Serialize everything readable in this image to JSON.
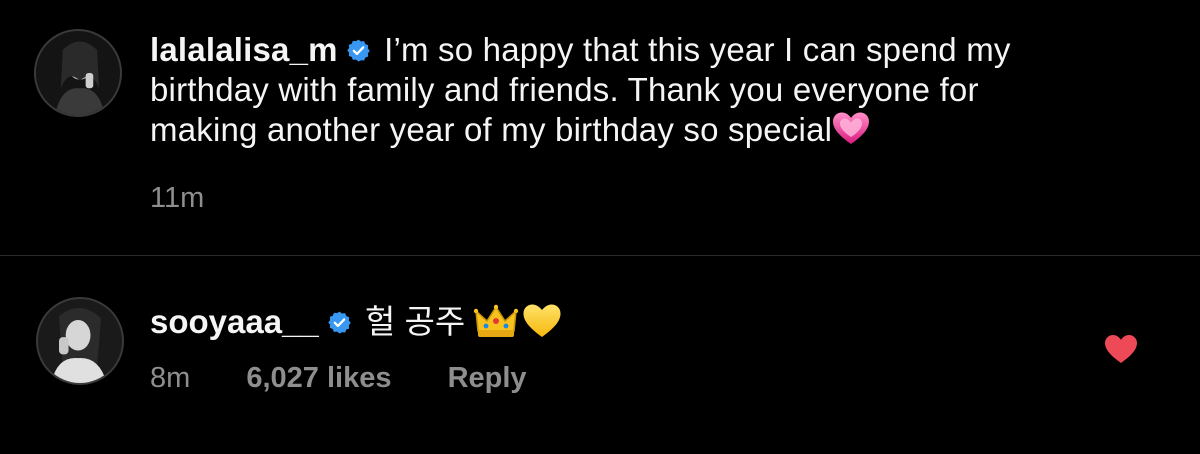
{
  "post": {
    "username": "lalalalisa_m",
    "verified": true,
    "caption": "I’m so happy that this year I can spend my birthday with family and friends. Thank you everyone for making another year of my birthday so special",
    "caption_line1": "I’m so happy that this year I can spend my",
    "caption_line2": "birthday with family and friends. Thank you everyone for",
    "caption_line3": "making another year of my birthday so special",
    "caption_emoji": "pink-heart-emoji",
    "time": "11m"
  },
  "comment": {
    "username": "sooyaaa__",
    "verified": true,
    "text": "헐 공주",
    "emojis": [
      "crown-emoji",
      "yellow-heart-emoji"
    ],
    "time": "8m",
    "likes": "6,027 likes",
    "reply_label": "Reply",
    "liked": true
  },
  "colors": {
    "background": "#000000",
    "text": "#f5f5f5",
    "secondary_text": "#8e8e8e",
    "verified_badge": "#3897f0",
    "like_red": "#ed4956",
    "divider": "#2b2b2b"
  }
}
